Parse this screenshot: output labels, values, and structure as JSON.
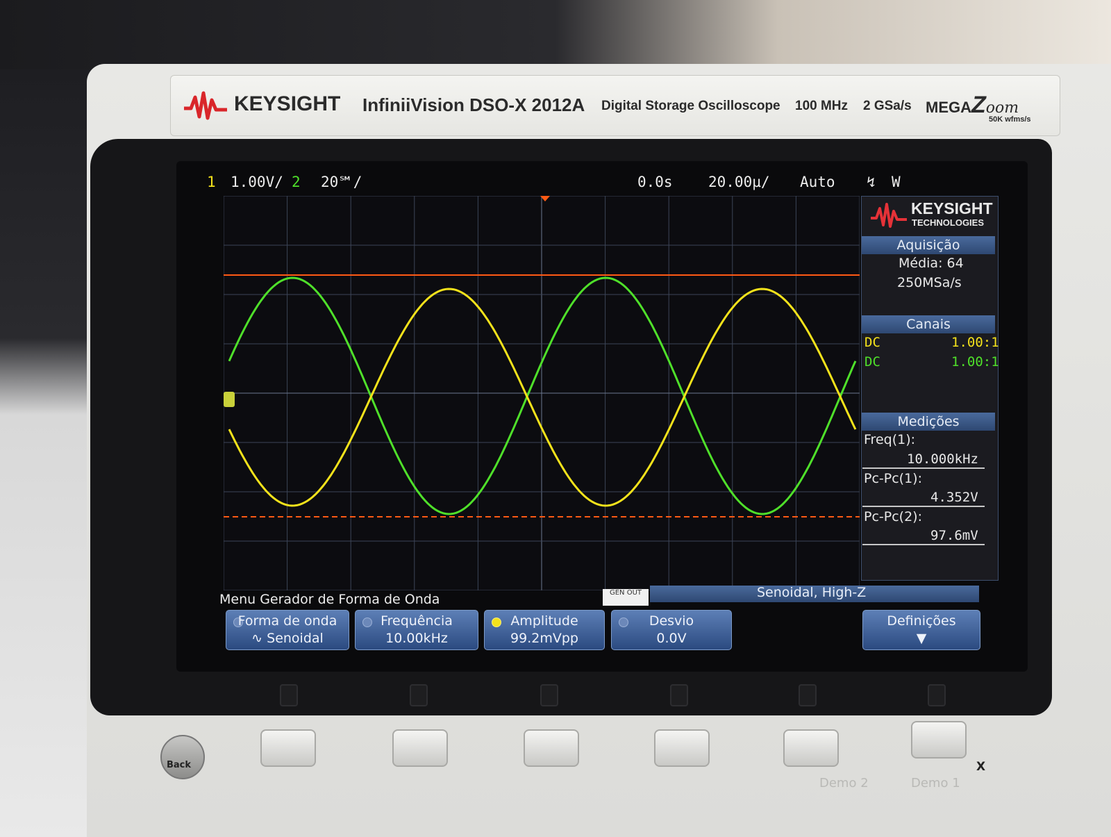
{
  "header": {
    "brand": "KEYSIGHT",
    "model": "InfiniiVision DSO-X 2012A",
    "description": "Digital Storage Oscilloscope",
    "bandwidth": "100 MHz",
    "sample_rate": "2 GSa/s",
    "megazoom": "MEGA",
    "megazoom_z": "Z",
    "megazoom_oom": "oom",
    "megazoom_sub": "50K wfms/s"
  },
  "status_bar": {
    "ch1_number": "1",
    "ch1_scale": "1.00V/",
    "ch2_number": "2",
    "ch2_scale": "20℠/",
    "time_delay": "0.0s",
    "time_scale": "20.00µ/",
    "trigger_mode": "Auto",
    "trigger_edge": "↯",
    "trigger_label": "W"
  },
  "side_panel": {
    "logo_name": "KEYSIGHT",
    "logo_sub": "TECHNOLOGIES",
    "acquisition": {
      "title": "Aquisição",
      "mode": "Média: 64",
      "rate": "250MSa/s"
    },
    "channels": {
      "title": "Canais",
      "rows": [
        {
          "coupling": "DC",
          "probe": "1.00:1"
        },
        {
          "coupling": "DC",
          "probe": "1.00:1"
        }
      ]
    },
    "measurements": {
      "title": "Medições",
      "items": [
        {
          "label": "Freq(1):",
          "value": "10.000kHz"
        },
        {
          "label": "Pc-Pc(1):",
          "value": "4.352V"
        },
        {
          "label": "Pc-Pc(2):",
          "value": "97.6mV"
        }
      ]
    }
  },
  "waveform_menu": {
    "title": "Menu Gerador de Forma de Onda",
    "genout_badge": "GEN OUT",
    "wave_info": "Senoidal, High-Z",
    "softkeys": [
      {
        "label": "Forma de onda",
        "value": "∿ Senoidal"
      },
      {
        "label": "Frequência",
        "value": "10.00kHz"
      },
      {
        "label": "Amplitude",
        "value": "99.2mVpp"
      },
      {
        "label": "Desvio",
        "value": "0.0V"
      },
      {
        "label": "Definições",
        "value": "▼"
      }
    ]
  },
  "front_panel": {
    "back_label": "Back",
    "demo2": "Demo 2",
    "demo1": "Demo 1",
    "x_label": "X"
  },
  "colors": {
    "channel1": "#f3e21b",
    "channel2": "#4fe02a",
    "cursor": "#ff5a14",
    "softkey": "#3d5f96"
  },
  "waveforms": {
    "channel1": {
      "waveform": "sine",
      "frequency_khz": 10.0,
      "cycles_on_screen": 2,
      "phase": "falling at left edge",
      "color_key": "channel1"
    },
    "channel2": {
      "waveform": "sine",
      "cycles_on_screen": 2,
      "phase": "rising at left edge",
      "color_key": "channel2"
    }
  }
}
